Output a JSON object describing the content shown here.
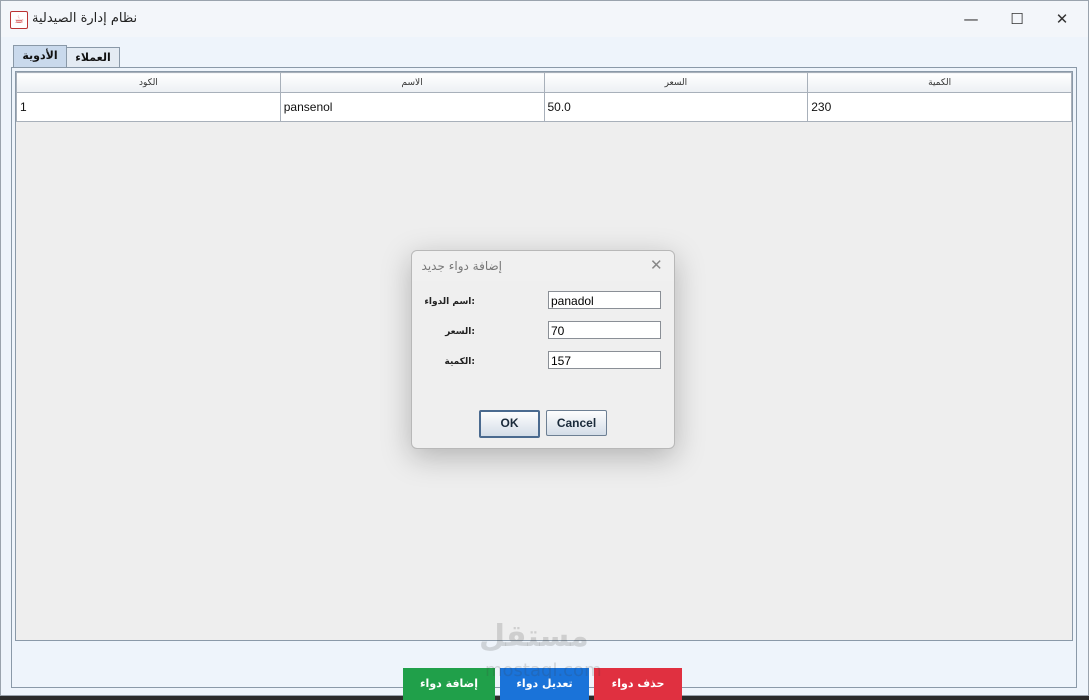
{
  "window": {
    "title": "نظام إدارة الصيدلية"
  },
  "tabs": [
    {
      "label": "الأدوية"
    },
    {
      "label": "العملاء"
    }
  ],
  "table": {
    "headers": [
      "الكود",
      "الاسم",
      "السعر",
      "الكمية"
    ],
    "rows": [
      [
        "1",
        "pansenol",
        "50.0",
        "230"
      ]
    ]
  },
  "dialog": {
    "title": "إضافة دواء جديد",
    "fields": [
      {
        "label": "اسم الدواء:",
        "value": "panadol"
      },
      {
        "label": "السعر:",
        "value": "70"
      },
      {
        "label": "الكمية:",
        "value": "157"
      }
    ],
    "ok_label": "OK",
    "cancel_label": "Cancel"
  },
  "actions": {
    "add_label": "إضافة دواء",
    "edit_label": "تعديل دواء",
    "delete_label": "حذف دواء"
  },
  "watermark": {
    "text": "مستقل",
    "url": "mostaql.com"
  },
  "colors": {
    "add": "#20a04a",
    "edit": "#1a73d9",
    "delete": "#e03040"
  }
}
